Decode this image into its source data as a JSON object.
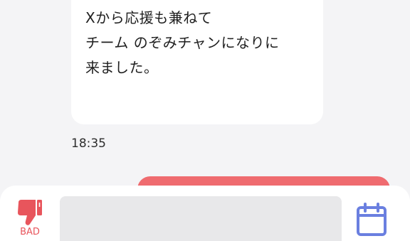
{
  "incoming_message": {
    "lines": [
      "Xから応援も兼ねて",
      "チーム のぞみチャンになりに",
      "来ました。"
    ],
    "time": "18:35"
  },
  "composer": {
    "bad_label": "BAD",
    "input_placeholder": "",
    "icons": {
      "bad": "thumbs-down-icon",
      "calendar": "calendar-icon"
    }
  },
  "colors": {
    "accent_red": "#ef6b6f",
    "bad_red": "#e8555c",
    "calendar_blue": "#6a7fe0"
  }
}
